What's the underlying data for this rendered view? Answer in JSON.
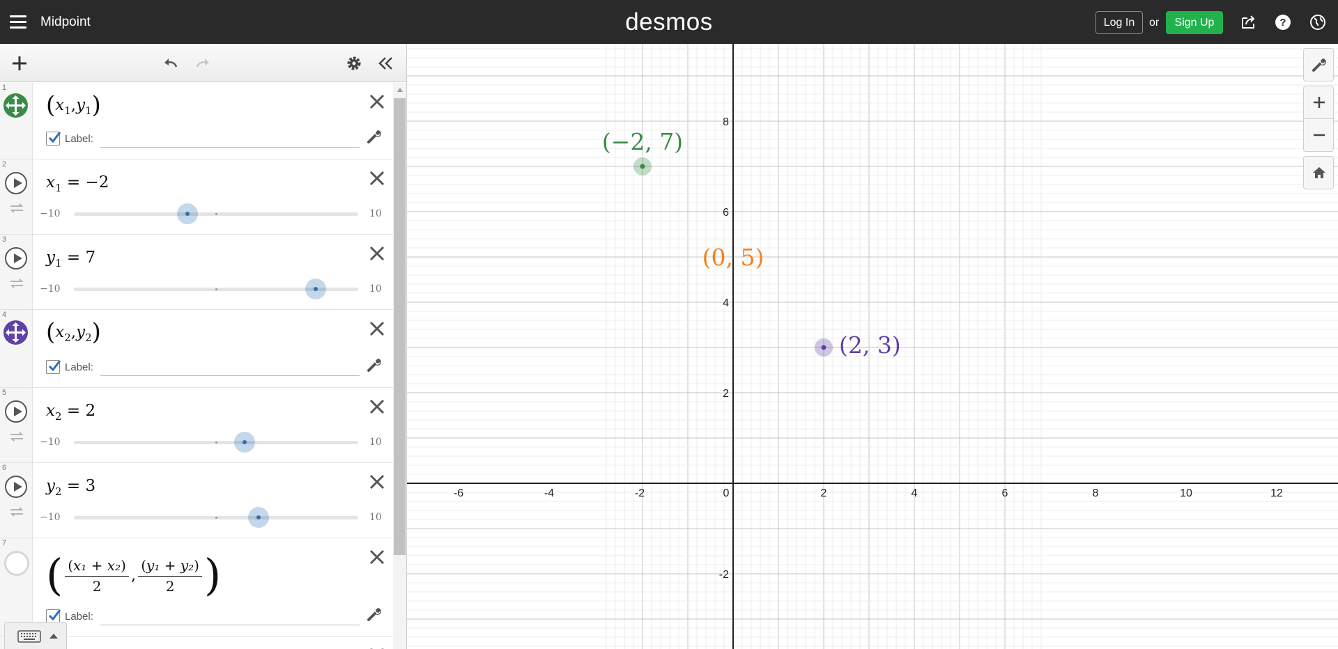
{
  "app": {
    "title": "Midpoint",
    "logo": "desmos"
  },
  "header": {
    "login_label": "Log In",
    "or_label": "or",
    "signup_label": "Sign Up",
    "icons": [
      "menu-icon",
      "share-icon",
      "help-icon",
      "language-globe-icon"
    ]
  },
  "colors": {
    "green": "#388c46",
    "purple": "#6042a6",
    "orange": "#fa7e19",
    "blue": "#2d70b3",
    "signup": "#22b24c"
  },
  "expressions": [
    {
      "index": "1",
      "kind": "point",
      "x_var": "x",
      "x_sub": "1",
      "y_var": "y",
      "y_sub": "1",
      "color": "#388c46",
      "label_text": "Label:",
      "label_value": "",
      "label_checked": true
    },
    {
      "index": "2",
      "kind": "slider",
      "var": "x",
      "sub": "1",
      "eq": " = ",
      "value": "−2",
      "min_label": "−10",
      "max_label": "10",
      "min": -10,
      "max": 10,
      "num": -2
    },
    {
      "index": "3",
      "kind": "slider",
      "var": "y",
      "sub": "1",
      "eq": " = ",
      "value": "7",
      "min_label": "−10",
      "max_label": "10",
      "min": -10,
      "max": 10,
      "num": 7
    },
    {
      "index": "4",
      "kind": "point",
      "x_var": "x",
      "x_sub": "2",
      "y_var": "y",
      "y_sub": "2",
      "color": "#6042a6",
      "label_text": "Label:",
      "label_value": "",
      "label_checked": true
    },
    {
      "index": "5",
      "kind": "slider",
      "var": "x",
      "sub": "2",
      "eq": " = ",
      "value": "2",
      "min_label": "−10",
      "max_label": "10",
      "min": -10,
      "max": 10,
      "num": 2
    },
    {
      "index": "6",
      "kind": "slider",
      "var": "y",
      "sub": "2",
      "eq": " = ",
      "value": "3",
      "min_label": "−10",
      "max_label": "10",
      "min": -10,
      "max": 10,
      "num": 3
    },
    {
      "index": "7",
      "kind": "midpoint",
      "num1": "x₁ + x₂",
      "num2": "y₁ + y₂",
      "den": "2",
      "label_text": "Label:",
      "label_value": "",
      "label_checked": true
    }
  ],
  "graph": {
    "x_ticks": [
      "-6",
      "-4",
      "-2",
      "0",
      "2",
      "4",
      "6",
      "8",
      "10",
      "12"
    ],
    "y_ticks": [
      "8",
      "6",
      "4",
      "2",
      "-2"
    ],
    "points": [
      {
        "label": "(−2, 7)",
        "x": -2,
        "y": 7,
        "color": "#388c46",
        "shown": true
      },
      {
        "label": "(2, 3)",
        "x": 2,
        "y": 3,
        "color": "#6042a6",
        "shown": true
      },
      {
        "label": "(0, 5)",
        "x": 0,
        "y": 5,
        "color": "#fa7e19",
        "shown": false
      }
    ]
  }
}
